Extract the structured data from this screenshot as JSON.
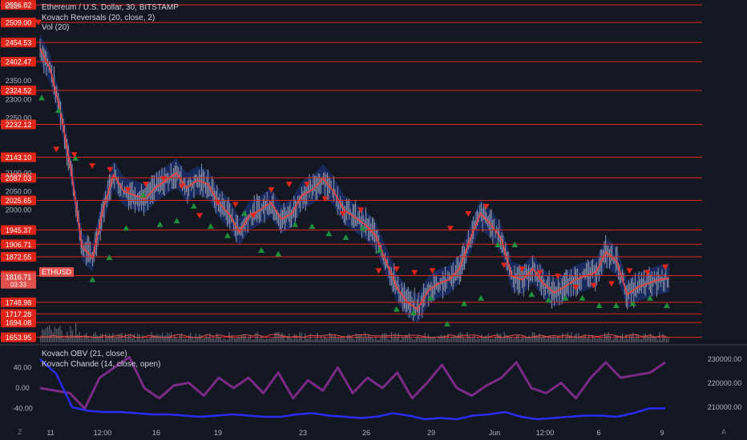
{
  "header": {
    "currency": "USD",
    "symbol_title": "Ethereum / U.S. Dollar, 30, BITSTAMP",
    "indicator_1": "Kovach Reversals (20, close, 2)",
    "indicator_2": "Vol (20)",
    "indicator_3": "Kovach OBV (21, close)",
    "indicator_4": "Kovach Chande (14, close, open)"
  },
  "ticker_badge": "ETHUSD",
  "last_price": {
    "value": "1816.71",
    "countdown": "03:33"
  },
  "corner_left": "Z",
  "corner_right": "A",
  "colors": {
    "background": "#131722",
    "level_line": "#e0251b",
    "badge": "#e0251b",
    "candle": "#b2b5be",
    "moving_average": "#e04646",
    "band": "#1e3a8a",
    "up_signal": "#1f8f3a",
    "down_signal": "#e0251b",
    "obv": "#2a2cf5",
    "chande": "#7b2a85"
  },
  "chart_data": [
    {
      "type": "line",
      "title": "Ethereum / U.S. Dollar, 30, BITSTAMP",
      "ylim": [
        1640,
        2570
      ],
      "x_ticks": [
        "11",
        "12:00",
        "16",
        "19",
        "23",
        "26",
        "29",
        "Jun",
        "12:00",
        "6",
        "9"
      ],
      "y_ticks": [
        2350.0,
        2300.0,
        2250.0,
        2100.0,
        2050.0,
        2000.0
      ],
      "price_levels": [
        2556.82,
        2509.0,
        2454.53,
        2402.47,
        2324.52,
        2232.12,
        2143.1,
        2087.03,
        2025.65,
        1945.37,
        1906.71,
        1872.55,
        1821.32,
        1748.98,
        1717.28,
        1694.08,
        1653.95
      ],
      "current_price": 1816.71,
      "close_path": [
        2440,
        2380,
        2260,
        2100,
        1900,
        1870,
        2000,
        2095,
        2050,
        2040,
        2030,
        2060,
        2080,
        2100,
        2060,
        2080,
        2070,
        2020,
        1990,
        1940,
        1985,
        2000,
        2020,
        1975,
        1990,
        2040,
        2055,
        2085,
        2050,
        2000,
        1980,
        1960,
        1930,
        1860,
        1790,
        1750,
        1730,
        1780,
        1800,
        1810,
        1840,
        1920,
        1990,
        1960,
        1920,
        1820,
        1810,
        1840,
        1800,
        1775,
        1790,
        1810,
        1820,
        1830,
        1885,
        1860,
        1770,
        1790,
        1800,
        1810,
        1815
      ],
      "up_signals": [
        2304,
        2270,
        2140,
        1810,
        1870,
        1950,
        2040,
        1960,
        1970,
        2010,
        1955,
        1930,
        1990,
        1890,
        1880,
        1960,
        1955,
        1935,
        1925,
        1950,
        1890,
        1730,
        1720,
        1760,
        1690,
        1745,
        1760,
        1905,
        1905,
        1770,
        1755,
        1760,
        1760,
        1740,
        1740,
        1745,
        1760,
        1740
      ],
      "down_signals": [
        2510,
        2165,
        2150,
        2120,
        2110,
        2055,
        2070,
        2085,
        2065,
        1985,
        2020,
        2015,
        1985,
        2055,
        2070,
        2070,
        2030,
        1990,
        2000,
        1835,
        1840,
        1830,
        1835,
        1950,
        1990,
        2010,
        1850,
        1840,
        1830,
        1820,
        1790,
        1795,
        1800,
        1835,
        1830,
        1845
      ]
    },
    {
      "type": "bar",
      "title": "Vol (20)"
    },
    {
      "type": "line",
      "series": [
        {
          "name": "Kovach OBV (21, close)",
          "values": [
            230000,
            224000,
            210000,
            208500,
            208000,
            208000,
            207500,
            207000,
            207000,
            206500,
            206000,
            206500,
            207000,
            206500,
            206000,
            206000,
            207000,
            207500,
            206500,
            206000,
            205500,
            206000,
            207500,
            206500,
            205000,
            205500,
            205000,
            206500,
            207000,
            208000,
            206000,
            205000,
            205500,
            206000,
            206500,
            206500,
            206000,
            207500,
            209500,
            209500
          ]
        },
        {
          "name": "Kovach Chande (14, close, open)",
          "values": [
            0,
            -5,
            -10,
            -40,
            20,
            40,
            60,
            0,
            -20,
            5,
            10,
            -15,
            20,
            0,
            20,
            -10,
            30,
            -20,
            15,
            -5,
            40,
            -10,
            20,
            0,
            30,
            -20,
            10,
            45,
            0,
            -15,
            5,
            20,
            50,
            0,
            -10,
            10,
            -20,
            20,
            50,
            20,
            25,
            30,
            50
          ]
        }
      ],
      "y_ticks_left": [
        40.0,
        0.0,
        -40.0
      ],
      "y_ticks_right": [
        230000.0,
        220000.0,
        210000.0
      ]
    }
  ]
}
